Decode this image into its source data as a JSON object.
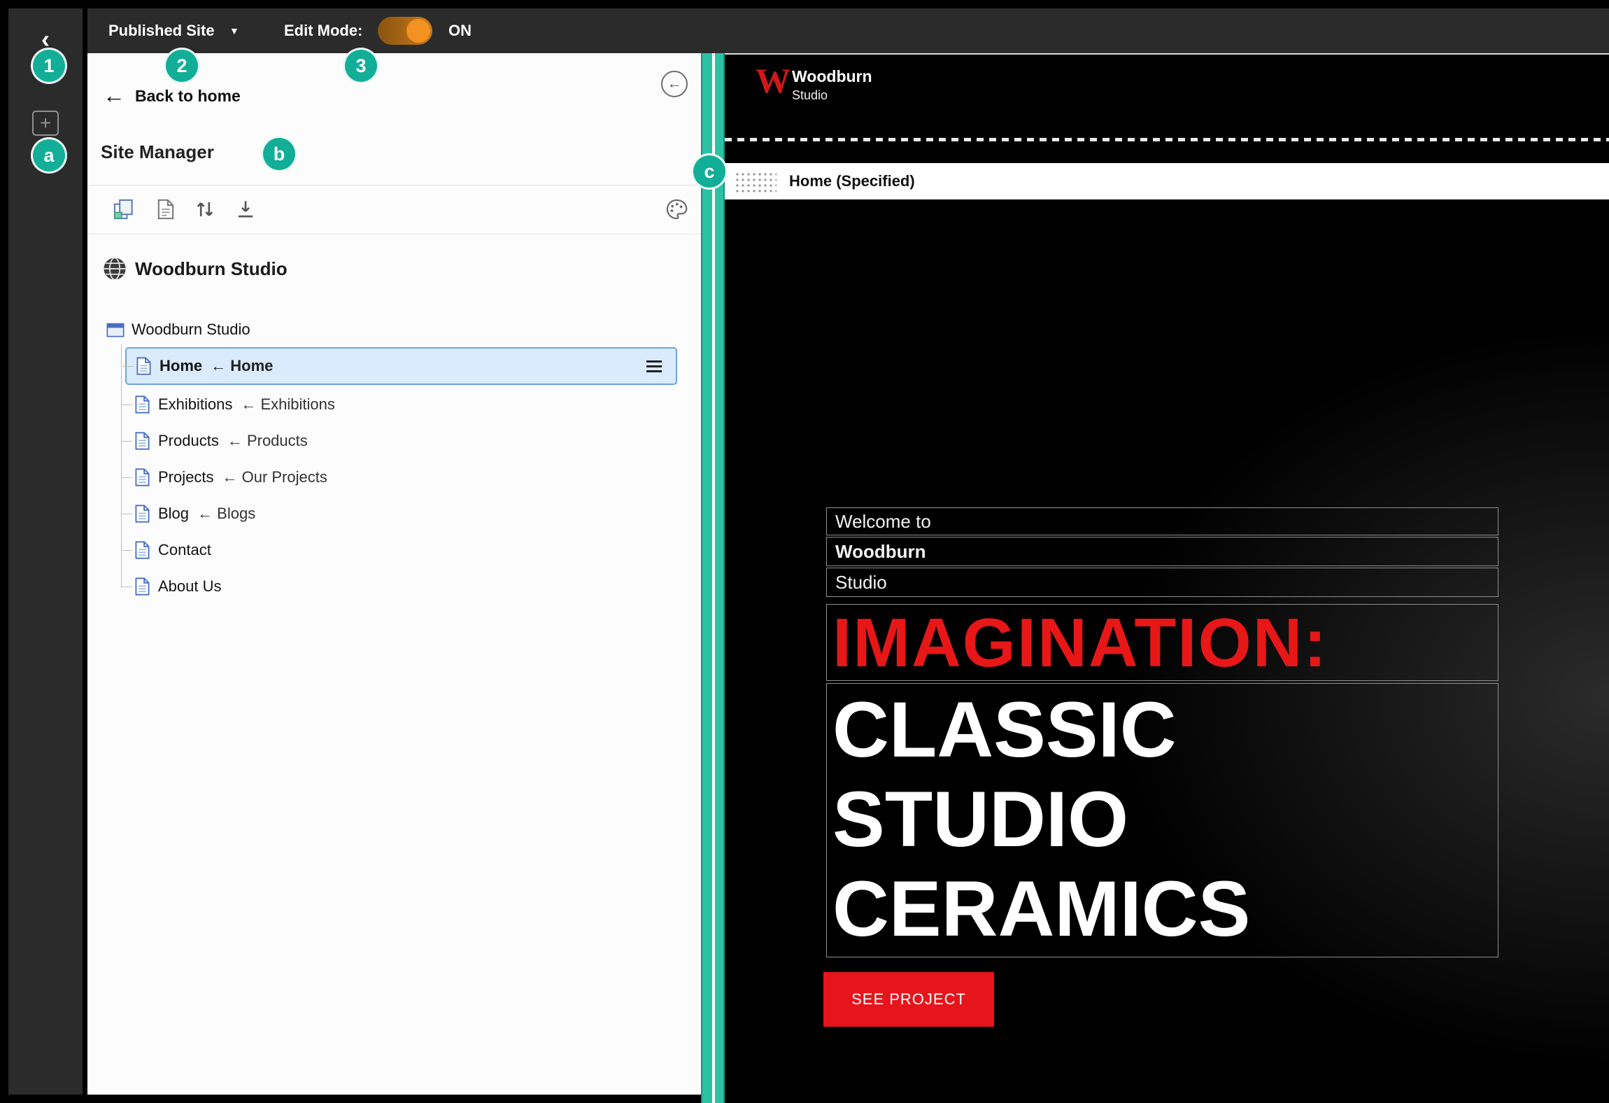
{
  "annotations": {
    "n1": "1",
    "n2": "2",
    "n3": "3",
    "la": "a",
    "lb": "b",
    "lc": "c"
  },
  "icons": {
    "back_chevron": "‹",
    "add_plus": "+",
    "caret_down": "▼",
    "back_arrow": "←",
    "collapse_arrow": "←"
  },
  "topbar": {
    "published_site": "Published Site",
    "edit_mode_label": "Edit Mode:",
    "toggle_state": "ON"
  },
  "panel": {
    "back_to_home": "Back to home",
    "title": "Site Manager",
    "site_title": "Woodburn Studio",
    "root_label": "Woodburn Studio",
    "tree": [
      {
        "name": "Home",
        "alias": "← Home"
      },
      {
        "name": "Exhibitions",
        "alias": "← Exhibitions"
      },
      {
        "name": "Products",
        "alias": "← Products"
      },
      {
        "name": "Projects",
        "alias": "← Our Projects"
      },
      {
        "name": "Blog",
        "alias": "← Blogs"
      },
      {
        "name": "Contact",
        "alias": ""
      },
      {
        "name": "About Us",
        "alias": ""
      }
    ]
  },
  "preview": {
    "logo_letter": "W",
    "logo_name": "Woodburn",
    "logo_sub": "Studio",
    "page_bar_label": "Home (Specified)",
    "hero_line1": "Welcome to",
    "hero_line2": "Woodburn",
    "hero_line3": "Studio",
    "headline_red": "IMAGINATION:",
    "headline_big": "CLASSIC STUDIO CERAMICS",
    "cta": "SEE PROJECT"
  },
  "colors": {
    "accent_teal": "#12ae97",
    "toggle_orange": "#f39122",
    "selected_row_blue": "#d9ebfd",
    "brand_red": "#e8141b",
    "bar_gray": "#2b2b2b"
  }
}
